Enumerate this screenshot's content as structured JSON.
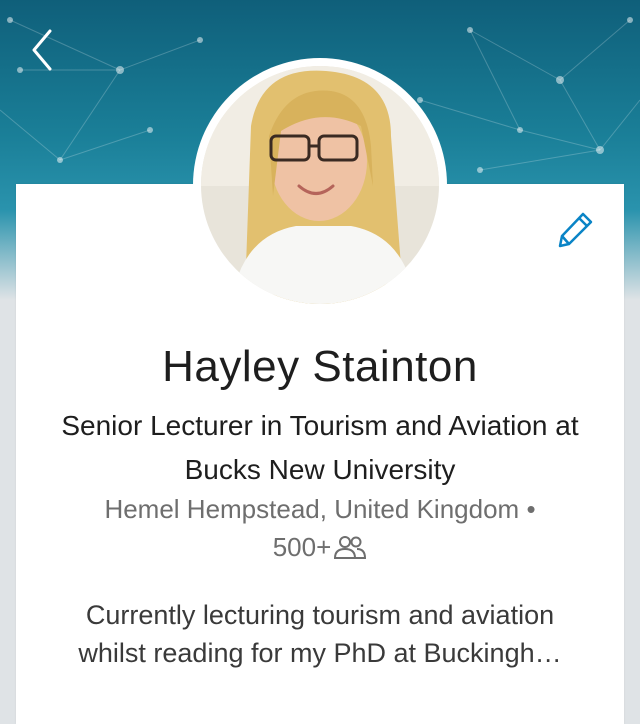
{
  "profile": {
    "name": "Hayley Stainton",
    "headline": "Senior Lecturer in Tourism and Aviation at Bucks New University",
    "location": "Hemel Hempstead, United Kingdom",
    "separator": "•",
    "connections": "500+",
    "summary": "Currently lecturing tourism and aviation whilst reading for my PhD at Buckingh…"
  },
  "icons": {
    "back": "chevron-left-icon",
    "edit": "pencil-icon",
    "connections": "people-icon"
  },
  "colors": {
    "banner": "#1a7f98",
    "accent": "#0a84c6",
    "text": "#1e1e1e",
    "muted": "#6e6e6e"
  }
}
